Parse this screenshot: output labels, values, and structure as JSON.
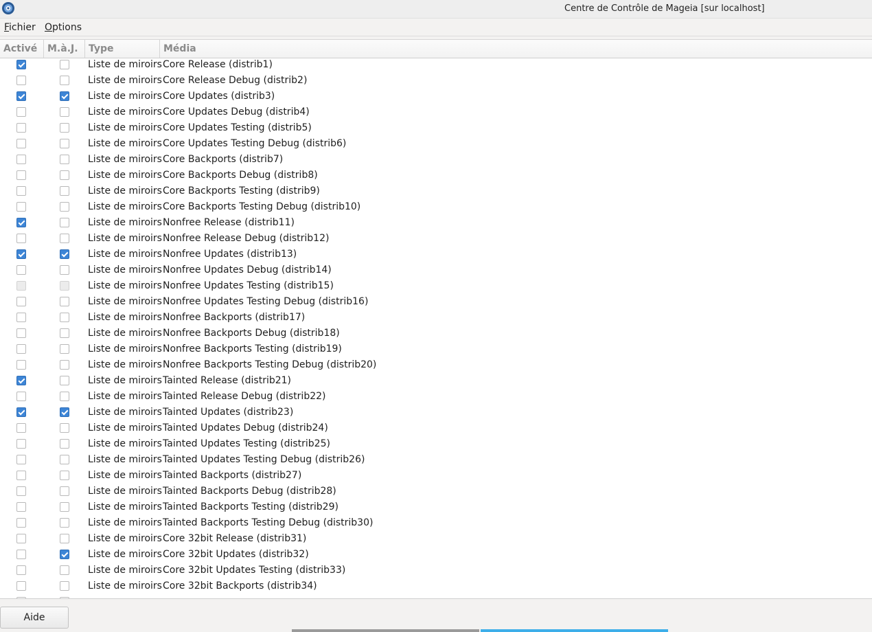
{
  "window": {
    "title": "Centre de Contrôle de Mageia [sur localhost]",
    "icon": "mageia-logo-icon"
  },
  "menu": [
    {
      "mnemonic": "F",
      "rest": "ichier"
    },
    {
      "mnemonic": "O",
      "rest": "ptions"
    }
  ],
  "table": {
    "headers": {
      "active": "Activé",
      "update": "M.à.J.",
      "type": "Type",
      "media": "Média"
    },
    "rows": [
      {
        "active": true,
        "update": false,
        "type": "Liste de miroirs",
        "media": "Core Release (distrib1)"
      },
      {
        "active": false,
        "update": false,
        "type": "Liste de miroirs",
        "media": "Core Release Debug (distrib2)"
      },
      {
        "active": true,
        "update": true,
        "type": "Liste de miroirs",
        "media": "Core Updates (distrib3)"
      },
      {
        "active": false,
        "update": false,
        "type": "Liste de miroirs",
        "media": "Core Updates Debug (distrib4)"
      },
      {
        "active": false,
        "update": false,
        "type": "Liste de miroirs",
        "media": "Core Updates Testing (distrib5)"
      },
      {
        "active": false,
        "update": false,
        "type": "Liste de miroirs",
        "media": "Core Updates Testing Debug (distrib6)"
      },
      {
        "active": false,
        "update": false,
        "type": "Liste de miroirs",
        "media": "Core Backports (distrib7)"
      },
      {
        "active": false,
        "update": false,
        "type": "Liste de miroirs",
        "media": "Core Backports Debug (distrib8)"
      },
      {
        "active": false,
        "update": false,
        "type": "Liste de miroirs",
        "media": "Core Backports Testing (distrib9)"
      },
      {
        "active": false,
        "update": false,
        "type": "Liste de miroirs",
        "media": "Core Backports Testing Debug (distrib10)"
      },
      {
        "active": true,
        "update": false,
        "type": "Liste de miroirs",
        "media": "Nonfree Release (distrib11)"
      },
      {
        "active": false,
        "update": false,
        "type": "Liste de miroirs",
        "media": "Nonfree Release Debug (distrib12)"
      },
      {
        "active": true,
        "update": true,
        "type": "Liste de miroirs",
        "media": "Nonfree Updates (distrib13)"
      },
      {
        "active": false,
        "update": false,
        "type": "Liste de miroirs",
        "media": "Nonfree Updates Debug (distrib14)"
      },
      {
        "active": false,
        "update": false,
        "disabled": true,
        "type": "Liste de miroirs",
        "media": "Nonfree Updates Testing (distrib15)"
      },
      {
        "active": false,
        "update": false,
        "type": "Liste de miroirs",
        "media": "Nonfree Updates Testing Debug (distrib16)"
      },
      {
        "active": false,
        "update": false,
        "type": "Liste de miroirs",
        "media": "Nonfree Backports (distrib17)"
      },
      {
        "active": false,
        "update": false,
        "type": "Liste de miroirs",
        "media": "Nonfree Backports Debug (distrib18)"
      },
      {
        "active": false,
        "update": false,
        "type": "Liste de miroirs",
        "media": "Nonfree Backports Testing (distrib19)"
      },
      {
        "active": false,
        "update": false,
        "type": "Liste de miroirs",
        "media": "Nonfree Backports Testing Debug (distrib20)"
      },
      {
        "active": true,
        "update": false,
        "type": "Liste de miroirs",
        "media": "Tainted Release (distrib21)"
      },
      {
        "active": false,
        "update": false,
        "type": "Liste de miroirs",
        "media": "Tainted Release Debug (distrib22)"
      },
      {
        "active": true,
        "update": true,
        "type": "Liste de miroirs",
        "media": "Tainted Updates (distrib23)"
      },
      {
        "active": false,
        "update": false,
        "type": "Liste de miroirs",
        "media": "Tainted Updates Debug (distrib24)"
      },
      {
        "active": false,
        "update": false,
        "type": "Liste de miroirs",
        "media": "Tainted Updates Testing (distrib25)"
      },
      {
        "active": false,
        "update": false,
        "type": "Liste de miroirs",
        "media": "Tainted Updates Testing Debug (distrib26)"
      },
      {
        "active": false,
        "update": false,
        "type": "Liste de miroirs",
        "media": "Tainted Backports (distrib27)"
      },
      {
        "active": false,
        "update": false,
        "type": "Liste de miroirs",
        "media": "Tainted Backports Debug (distrib28)"
      },
      {
        "active": false,
        "update": false,
        "type": "Liste de miroirs",
        "media": "Tainted Backports Testing (distrib29)"
      },
      {
        "active": false,
        "update": false,
        "type": "Liste de miroirs",
        "media": "Tainted Backports Testing Debug (distrib30)"
      },
      {
        "active": false,
        "update": false,
        "type": "Liste de miroirs",
        "media": "Core 32bit Release (distrib31)"
      },
      {
        "active": false,
        "update": true,
        "type": "Liste de miroirs",
        "media": "Core 32bit Updates (distrib32)"
      },
      {
        "active": false,
        "update": false,
        "type": "Liste de miroirs",
        "media": "Core 32bit Updates Testing (distrib33)"
      },
      {
        "active": false,
        "update": false,
        "type": "Liste de miroirs",
        "media": "Core 32bit Backports (distrib34)"
      },
      {
        "active": false,
        "update": false,
        "type": "",
        "media": ""
      }
    ]
  },
  "footer": {
    "help_label": "Aide"
  },
  "colors": {
    "checkbox_checked": "#3d85d6",
    "accent_strip": "#3daee9"
  }
}
